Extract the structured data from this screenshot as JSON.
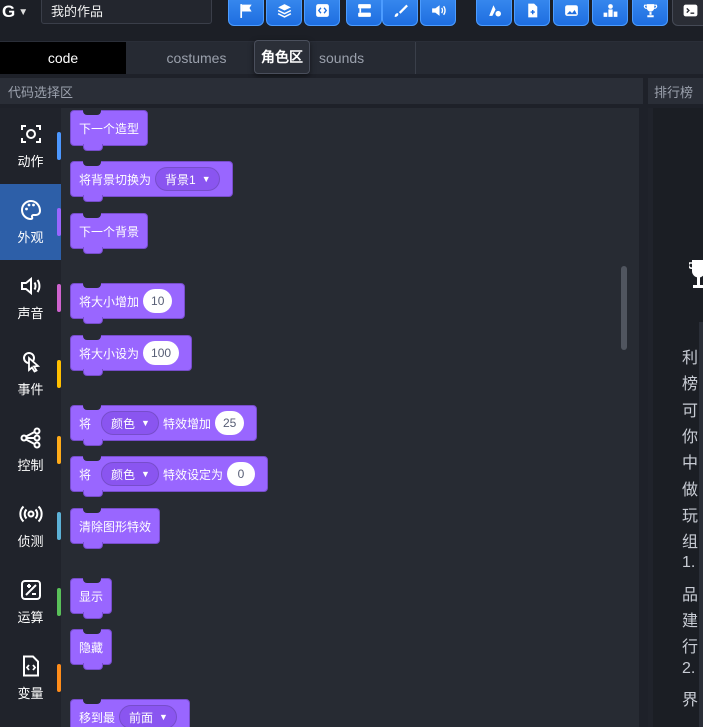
{
  "header": {
    "logo": "G",
    "title_value": "我的作品"
  },
  "toolbar": {
    "buttons": [
      "flag-icon",
      "layers-icon",
      "code-icon",
      "flowchart-icon",
      "brush-icon",
      "volume-icon",
      "shapes-icon",
      "file-plus-icon",
      "image-icon",
      "people-icon",
      "trophy-icon",
      "terminal-icon"
    ]
  },
  "tabs": {
    "code": "code",
    "costumes": "costumes",
    "sounds": "sounds",
    "tooltip": "角色区"
  },
  "sections": {
    "code_picker": "代码选择区",
    "leaderboard": "排行榜"
  },
  "categories": [
    {
      "label": "动作",
      "icon": "motion-icon",
      "color": "#4c97ff"
    },
    {
      "label": "外观",
      "icon": "palette-icon",
      "color": "#9966ff"
    },
    {
      "label": "声音",
      "icon": "speaker-icon",
      "color": "#cf63cf"
    },
    {
      "label": "事件",
      "icon": "pointer-icon",
      "color": "#ffbf00"
    },
    {
      "label": "控制",
      "icon": "branch-icon",
      "color": "#ffab19"
    },
    {
      "label": "侦测",
      "icon": "sensing-icon",
      "color": "#5cb1d6"
    },
    {
      "label": "运算",
      "icon": "operators-icon",
      "color": "#59c059"
    },
    {
      "label": "变量",
      "icon": "variables-icon",
      "color": "#ff8c1a"
    }
  ],
  "blocks": {
    "next_costume": "下一个造型",
    "switch_backdrop": "将背景切换为",
    "backdrop_value": "背景1",
    "next_backdrop": "下一个背景",
    "change_size": "将大小增加",
    "change_size_value": "10",
    "set_size": "将大小设为",
    "set_size_value": "100",
    "change_effect_prefix": "将",
    "change_effect_drop": "颜色",
    "change_effect": "特效增加",
    "change_effect_value": "25",
    "set_effect_prefix": "将",
    "set_effect_drop": "颜色",
    "set_effect": "特效设定为",
    "set_effect_value": "0",
    "clear_effects": "清除图形特效",
    "show": "显示",
    "hide": "隐藏",
    "go_to_layer": "移到最",
    "layer_value": "前面"
  },
  "leaderboard_text": [
    "利",
    "榜",
    "可",
    "你",
    "中",
    "做",
    "玩",
    "组",
    "1.",
    "品",
    "建",
    "行",
    "2.",
    "界"
  ],
  "colors": {
    "looks": "#9966ff",
    "accent": "#1e6ee0",
    "active_category": "#2d5fa8"
  }
}
